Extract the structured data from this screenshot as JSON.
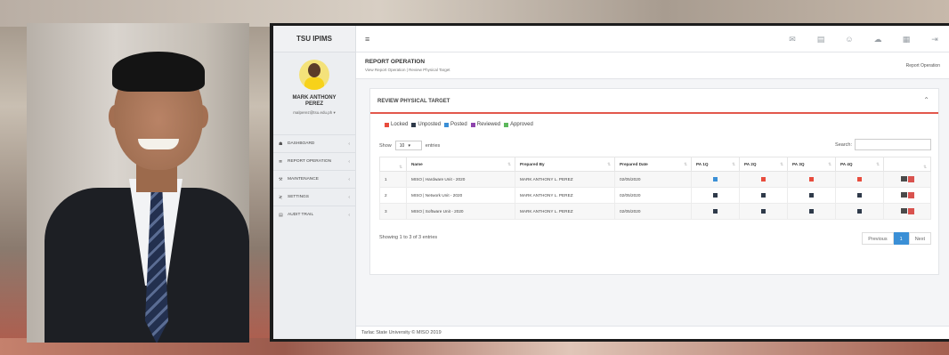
{
  "app": {
    "brand": "TSU IPIMS"
  },
  "profile": {
    "name_line1": "MARK ANTHONY",
    "name_line2": "PEREZ",
    "email": "malperez@tsu.edu.ph ▾"
  },
  "sidebar": {
    "items": [
      {
        "label": "DASHBOARD",
        "icon": "dashboard-icon"
      },
      {
        "label": "REPORT OPERATION",
        "icon": "list-icon"
      },
      {
        "label": "MAINTENANCE",
        "icon": "wrench-icon"
      },
      {
        "label": "SETTINGS",
        "icon": "sliders-icon"
      },
      {
        "label": "AUDIT TRAIL",
        "icon": "file-icon"
      }
    ]
  },
  "header": {
    "title": "REPORT OPERATION",
    "subtitle": "View Report Operation | Review Physical Target",
    "breadcrumb": "Report Operation"
  },
  "card": {
    "title": "REVIEW PHYSICAL TARGET",
    "legend": [
      {
        "label": "Locked",
        "color": "#e84c3d"
      },
      {
        "label": "Unposted",
        "color": "#2f3a4a"
      },
      {
        "label": "Posted",
        "color": "#3a8fd6"
      },
      {
        "label": "Reviewed",
        "color": "#8e44ad"
      },
      {
        "label": "Approved",
        "color": "#5cb85c"
      }
    ],
    "show_label": "Show",
    "show_value": "10",
    "entries_label": "entries",
    "search_label": "Search:",
    "columns": [
      "",
      "Name",
      "Prepared By",
      "Prepared Date",
      "PA 1Q",
      "PA 2Q",
      "PA 3Q",
      "PA 4Q",
      ""
    ],
    "rows": [
      {
        "no": "1",
        "name": "MISO | Hardware Unit - 2020",
        "prepared_by": "MARK ANTHONY L. PEREZ",
        "date": "02/05/2020",
        "q": [
          "#3a8fd6",
          "#e84c3d",
          "#e84c3d",
          "#e84c3d"
        ]
      },
      {
        "no": "2",
        "name": "MISO | Network Unit - 2020",
        "prepared_by": "MARK ANTHONY L. PEREZ",
        "date": "02/05/2020",
        "q": [
          "#2f3a4a",
          "#2f3a4a",
          "#2f3a4a",
          "#2f3a4a"
        ]
      },
      {
        "no": "3",
        "name": "MISO | Software Unit - 2020",
        "prepared_by": "MARK ANTHONY L. PEREZ",
        "date": "02/05/2020",
        "q": [
          "#2f3a4a",
          "#2f3a4a",
          "#2f3a4a",
          "#2f3a4a"
        ]
      }
    ],
    "info": "Showing 1 to 3 of 3 entries",
    "pager": {
      "prev": "Previous",
      "current": "1",
      "next": "Next"
    }
  },
  "footer": {
    "text": "Tarlac State University © MISO 2019"
  }
}
